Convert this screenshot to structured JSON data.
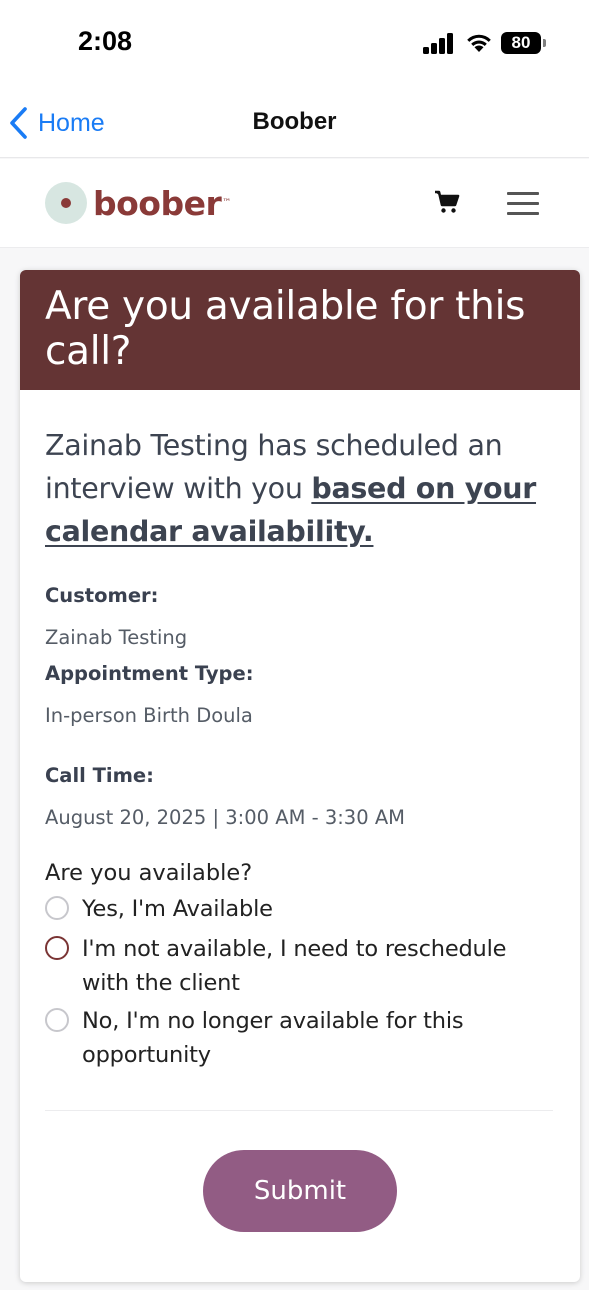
{
  "status_bar": {
    "time": "2:08",
    "battery": "80",
    "icons": [
      "signal-icon",
      "wifi-icon",
      "battery-icon"
    ]
  },
  "nav_bar": {
    "back_label": "Home",
    "title": "Boober",
    "accent_color": "#1a7cf5"
  },
  "header": {
    "logo_text": "boober",
    "logo_tm": "™",
    "brand_color": "#8a3a38",
    "icons": [
      "cart-icon",
      "menu-icon"
    ]
  },
  "card": {
    "title": "Are you available for this call?",
    "header_color": "#643434",
    "intro_text": "Zainab Testing has scheduled an interview with you ",
    "intro_link": "based on your calendar availability.",
    "fields": [
      {
        "label": "Customer:",
        "value": "Zainab Testing"
      },
      {
        "label": "Appointment Type:",
        "value": "In-person Birth Doula"
      },
      {
        "label": "Call Time:",
        "value": "August 20, 2025 | 3:00 AM - 3:30 AM"
      }
    ],
    "question": "Are you available?",
    "options": [
      {
        "label": "Yes, I'm Available",
        "selected": false
      },
      {
        "label": "I'm not available, I need to reschedule with the client",
        "selected": false
      },
      {
        "label": "No, I'm no longer available for this opportunity",
        "selected": false
      }
    ],
    "submit_label": "Submit",
    "submit_color": "#925c84"
  }
}
